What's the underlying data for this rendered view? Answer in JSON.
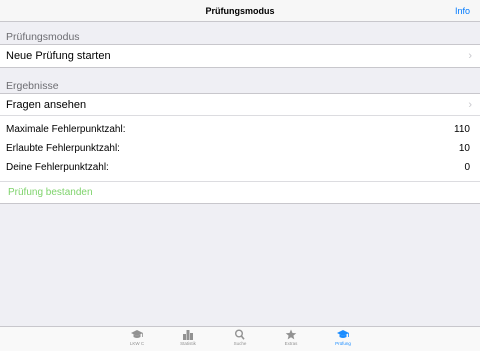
{
  "navbar": {
    "title": "Prüfungsmodus",
    "info_label": "Info"
  },
  "section1": {
    "header": "Prüfungsmodus",
    "start_label": "Neue Prüfung starten"
  },
  "section2": {
    "header": "Ergebnisse",
    "questions_label": "Fragen ansehen",
    "stats": [
      {
        "label": "Maximale Fehlerpunktzahl:",
        "value": "110"
      },
      {
        "label": "Erlaubte Fehlerpunktzahl:",
        "value": "10"
      },
      {
        "label": "Deine Fehlerpunktzahl:",
        "value": "0"
      }
    ],
    "result_label": "Prüfung bestanden"
  },
  "tabbar": {
    "tabs": [
      {
        "label": "LKW C",
        "icon": "graduation-cap-icon"
      },
      {
        "label": "Statistik",
        "icon": "bar-chart-icon"
      },
      {
        "label": "Suche",
        "icon": "search-icon"
      },
      {
        "label": "Extras",
        "icon": "star-icon"
      },
      {
        "label": "Prüfung",
        "icon": "graduation-cap-icon"
      }
    ],
    "active_index": 4
  },
  "colors": {
    "accent": "#007aff",
    "passed": "#7ed36b",
    "inactive": "#929292"
  }
}
